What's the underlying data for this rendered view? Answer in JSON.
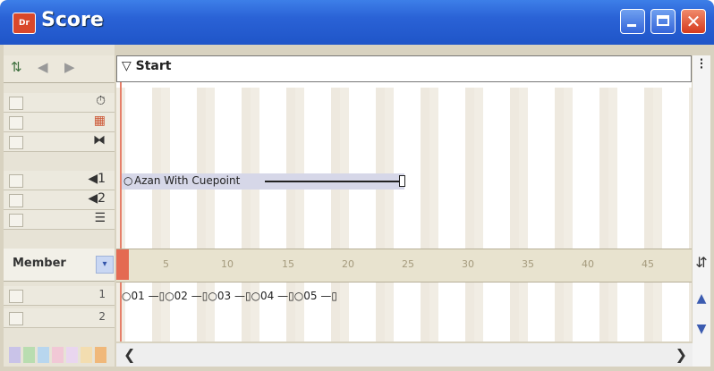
{
  "window": {
    "title": "Score",
    "app_icon_text": "Dr",
    "close_glyph": "✕"
  },
  "nav": {
    "menu_glyph": "⇅",
    "prev_glyph": "◀",
    "next_glyph": "▶"
  },
  "marker": {
    "label": "Start"
  },
  "channels": [
    {
      "name": "tempo",
      "icon": "⏱"
    },
    {
      "name": "palette",
      "icon": "▦"
    },
    {
      "name": "transition",
      "icon": "⧓"
    },
    {
      "name": "sound1",
      "icon": "◀1"
    },
    {
      "name": "sound2",
      "icon": "◀2"
    },
    {
      "name": "script",
      "icon": "☰"
    }
  ],
  "member_select": {
    "value": "Member",
    "arrow": "▾"
  },
  "sprite_channels": [
    {
      "num": "1"
    },
    {
      "num": "2"
    }
  ],
  "sound_sprite": {
    "label": "Azan With Cuepoint"
  },
  "cue_sprites": [
    "01",
    "02",
    "03",
    "04",
    "05"
  ],
  "ruler": {
    "ticks": [
      "5",
      "10",
      "15",
      "20",
      "25",
      "30",
      "35",
      "40",
      "45"
    ]
  },
  "scroll": {
    "up": "▲",
    "down": "▼",
    "left": "❮",
    "right": "❯"
  },
  "colors": {
    "title_bar": "#2a62d6",
    "playhead": "#e46a52",
    "sprite": "#d6d7e8"
  }
}
